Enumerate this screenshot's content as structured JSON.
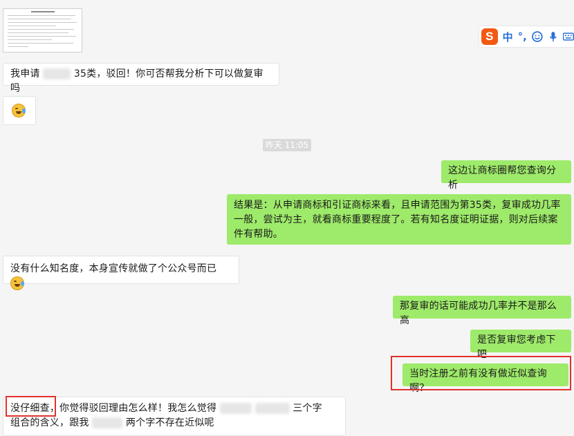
{
  "messages": {
    "m1_prefix": "我申请",
    "m1_suffix": "35类，驳回！你可否帮我分析下可以做复审吗",
    "timestamp": "昨天 11:05",
    "m2": "这边让商标圈帮您查询分析",
    "m3": "结果是：从申请商标和引证商标来看，且申请范围为第35类，复审成功几率一般，尝试为主，就看商标重要程度了。若有知名度证明证据，则对后续案件有帮助。",
    "m4": "没有什么知名度，本身宣传就做了个公众号而已",
    "m5": "那复审的话可能成功几率并不是那么高",
    "m6": "是否复审您考虑下吧",
    "m7": "当时注册之前有没有做近似查询啊？",
    "m8_highlight": "没仔细查",
    "m8_part1": "，你觉得驳回理由怎么样！我怎么觉得",
    "m8_part2": "三个字",
    "m8_part3": "组合的含义，跟我",
    "m8_part4": "两个字不存在近似呢"
  },
  "toolbar": {
    "logo": "S",
    "lang": "中",
    "punct": "°,",
    "icons": [
      "smiley-icon",
      "microphone-icon",
      "keyboard-icon"
    ]
  },
  "colors": {
    "outgoing_bubble": "#9eea6a",
    "incoming_bubble": "#ffffff",
    "highlight_border": "#e0312c",
    "ime_brand": "#f25a12"
  }
}
